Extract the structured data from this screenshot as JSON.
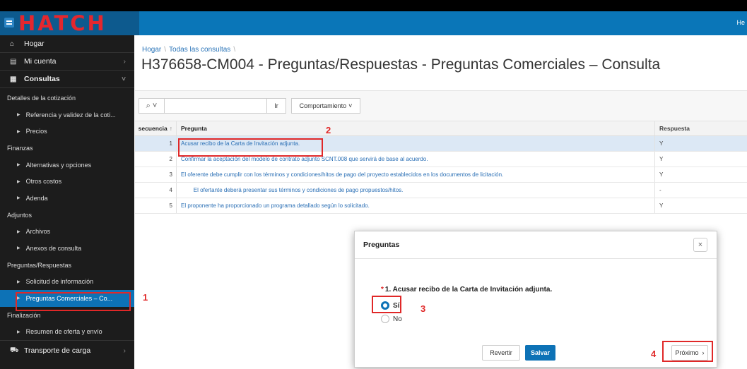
{
  "app": {
    "logo": "HATCH",
    "header_right": "He"
  },
  "sidebar": {
    "hogar": "Hogar",
    "mi_cuenta": "Mi cuenta",
    "consultas": "Consultas",
    "transporte": "Transporte de carga",
    "entries": [
      {
        "type": "section",
        "label": "Detalles de la cotización"
      },
      {
        "type": "item",
        "label": "Referencia y validez de la coti..."
      },
      {
        "type": "item",
        "label": "Precios"
      },
      {
        "type": "section",
        "label": "Finanzas"
      },
      {
        "type": "item",
        "label": "Alternativas y opciones"
      },
      {
        "type": "item",
        "label": "Otros costos"
      },
      {
        "type": "item",
        "label": "Adenda"
      },
      {
        "type": "section",
        "label": "Adjuntos"
      },
      {
        "type": "item",
        "label": "Archivos"
      },
      {
        "type": "item",
        "label": "Anexos de consulta"
      },
      {
        "type": "section",
        "label": "Preguntas/Respuestas"
      },
      {
        "type": "item",
        "label": "Solicitud de información"
      },
      {
        "type": "item",
        "label": "Preguntas Comerciales – Co...",
        "active": true
      },
      {
        "type": "section",
        "label": "Finalización"
      },
      {
        "type": "item",
        "label": "Resumen de oferta y envío"
      }
    ]
  },
  "breadcrumb": {
    "home": "Hogar",
    "sep": "\\",
    "all": "Todas las consultas"
  },
  "page_title": "H376658-CM004 - Preguntas/Respuestas - Preguntas Comerciales – Consulta",
  "toolbar": {
    "go": "Ir",
    "actions": "Comportamiento"
  },
  "grid": {
    "col_seq": "secuencia",
    "col_question": "Pregunta",
    "col_answer": "Respuesta",
    "rows": [
      {
        "seq": "1",
        "question": "Acusar recibo de la Carta de Invitación adjunta.",
        "answer": "Y"
      },
      {
        "seq": "2",
        "question": "Confirmar la aceptación del modelo de contrato adjunto SCNT.008 que servirá de base al acuerdo.",
        "answer": "Y"
      },
      {
        "seq": "3",
        "question": "El oferente debe cumplir con los términos y condiciones/hitos de pago del proyecto establecidos en los documentos de licitación.",
        "answer": "Y"
      },
      {
        "seq": "4",
        "question": "        El ofertante deberá presentar sus términos y condiciones de pago propuestos/hitos.",
        "answer": "-"
      },
      {
        "seq": "5",
        "question": "El proponente ha proporcionado un programa detallado según lo solicitado.",
        "answer": "Y"
      }
    ]
  },
  "modal": {
    "title": "Preguntas",
    "close": "×",
    "question": "1. Acusar recibo de la Carta de Invitación adjunta.",
    "req": "*",
    "opt_yes": "Sí",
    "opt_no": "No",
    "revert": "Revertir",
    "save": "Salvar",
    "next": "Próximo"
  },
  "annotations": {
    "a1": "1",
    "a2": "2",
    "a3": "3",
    "a4": "4"
  },
  "colors": {
    "header": "#0a76b8",
    "sidebar": "#1c1c1c",
    "accent": "#0d72b6",
    "annotation": "#e02828",
    "logo": "#e4272e"
  }
}
